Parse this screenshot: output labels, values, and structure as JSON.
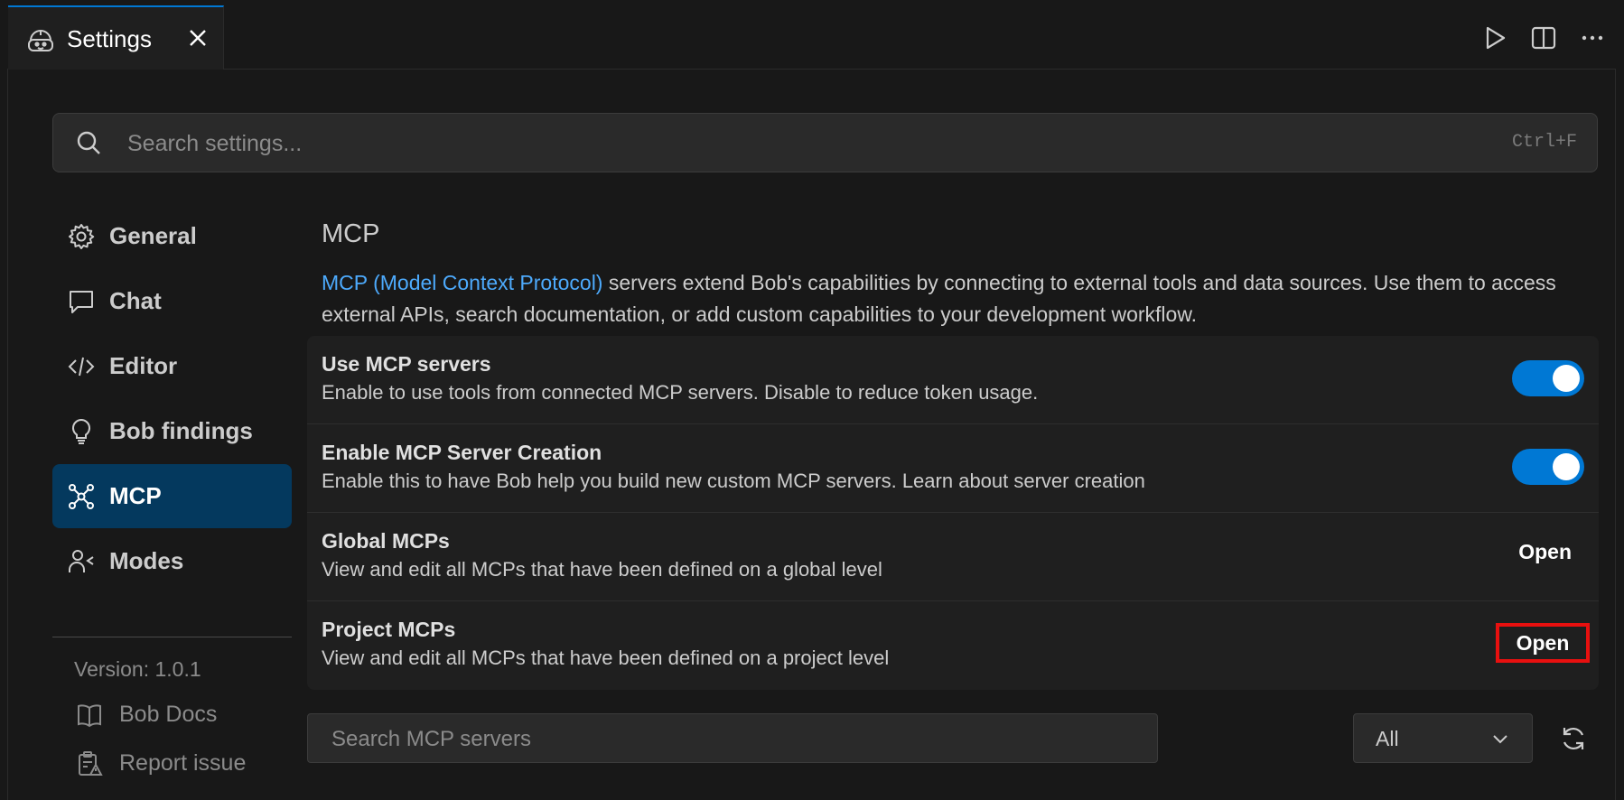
{
  "tab": {
    "title": "Settings"
  },
  "search": {
    "placeholder": "Search settings...",
    "shortcut": "Ctrl+F"
  },
  "sidebar": {
    "items": [
      {
        "label": "General",
        "icon": "gear-icon"
      },
      {
        "label": "Chat",
        "icon": "chat-icon"
      },
      {
        "label": "Editor",
        "icon": "code-icon"
      },
      {
        "label": "Bob findings",
        "icon": "lightbulb-icon"
      },
      {
        "label": "MCP",
        "icon": "mcp-network-icon",
        "active": true
      },
      {
        "label": "Modes",
        "icon": "modes-user-icon"
      }
    ],
    "version": "Version: 1.0.1",
    "links": [
      {
        "label": "Bob Docs",
        "icon": "book-icon"
      },
      {
        "label": "Report issue",
        "icon": "report-issue-icon"
      }
    ]
  },
  "main": {
    "section_title": "MCP",
    "desc_link": "MCP (Model Context Protocol)",
    "desc_text": " servers extend Bob's capabilities by connecting to external tools and data sources. Use them to access external APIs, search documentation, or add custom capabilities to your development workflow.",
    "rows": [
      {
        "title": "Use MCP servers",
        "desc": "Enable to use tools from connected MCP servers. Disable to reduce token usage.",
        "control": "toggle",
        "on": true
      },
      {
        "title": "Enable MCP Server Creation",
        "desc": "Enable this to have Bob help you build new custom MCP servers. Learn about server creation",
        "control": "toggle",
        "on": true
      },
      {
        "title": "Global MCPs",
        "desc": "View and edit all MCPs that have been defined on a global level",
        "control": "button",
        "button_label": "Open"
      },
      {
        "title": "Project MCPs",
        "desc": "View and edit all MCPs that have been defined on a project level",
        "control": "button",
        "button_label": "Open"
      }
    ],
    "mcp_search": {
      "placeholder": "Search MCP servers"
    },
    "filter": {
      "value": "All"
    }
  },
  "colors": {
    "accent": "#0078d4",
    "active_nav": "#04395e",
    "link": "#4daafc",
    "highlight": "#e8100f"
  }
}
